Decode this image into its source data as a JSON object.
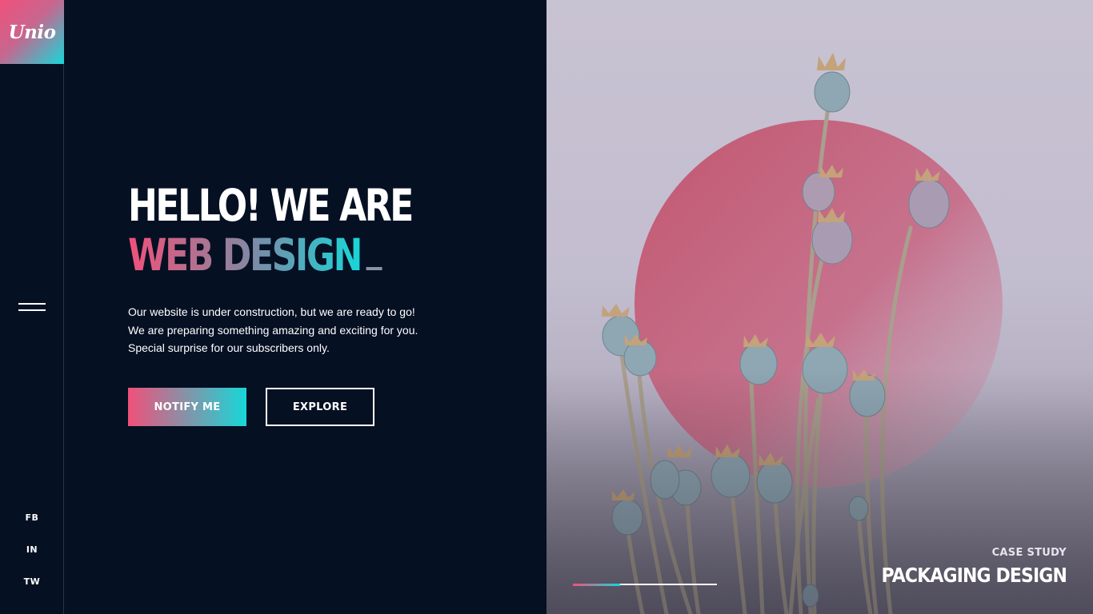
{
  "brand": {
    "logo_text": "Unio",
    "gradient": [
      "#f0517a",
      "#17d7d9"
    ]
  },
  "sidebar": {
    "menu_icon": "hamburger-icon",
    "social": [
      {
        "label": "FB"
      },
      {
        "label": "IN"
      },
      {
        "label": "TW"
      }
    ]
  },
  "hero": {
    "line1": "HELLO! WE ARE",
    "line2": "WEB DESIGN",
    "description": [
      "Our website is under construction, but we are ready to go!",
      "We are preparing something amazing and exciting for you.",
      "Special surprise for our subscribers only."
    ],
    "buttons": {
      "notify": "NOTIFY ME",
      "explore": "EXPLORE"
    }
  },
  "slide": {
    "label": "CASE STUDY",
    "title": "PACKAGING DESIGN",
    "progress": 0.33
  },
  "colors": {
    "background": "#061023",
    "accent_pink": "#f0517a",
    "accent_cyan": "#17d7d9",
    "circle": "#c2566f"
  }
}
